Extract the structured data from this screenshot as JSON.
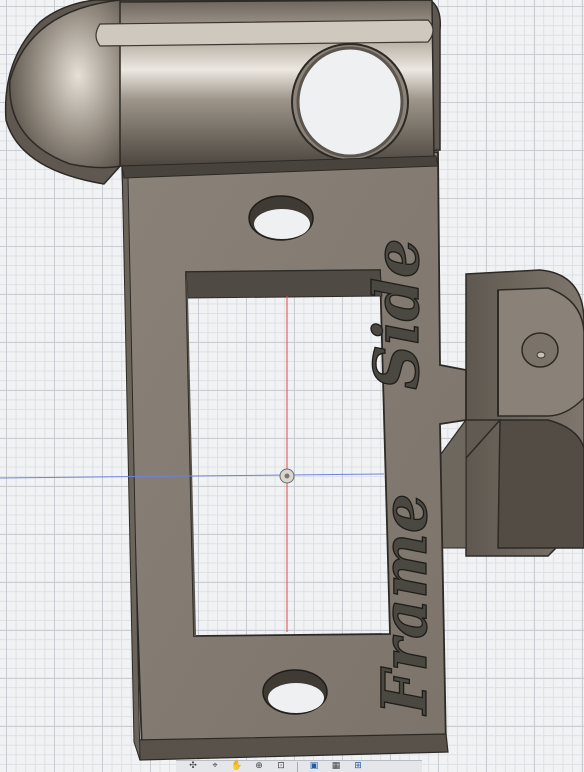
{
  "viewport": {
    "engraved_text": {
      "word1": "Side",
      "word2": "Frame"
    },
    "model_color": "#827a70",
    "axis_colors": {
      "vertical_axis": "#e0494a",
      "horizontal_axis": "#6f83d8"
    }
  },
  "toolbar": {
    "icons": [
      "orbit-icon",
      "look-at-icon",
      "pan-icon",
      "zoom-icon",
      "fit-icon",
      "display-style-icon",
      "grid-icon",
      "viewports-icon"
    ]
  }
}
